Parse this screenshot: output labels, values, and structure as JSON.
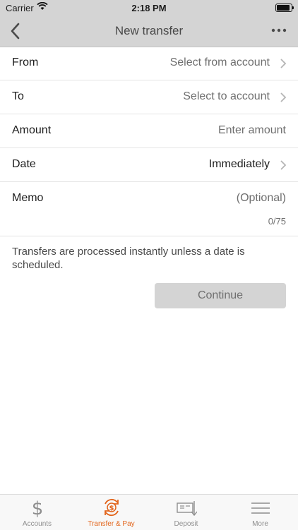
{
  "status": {
    "carrier": "Carrier",
    "time": "2:18 PM"
  },
  "nav": {
    "title": "New transfer",
    "back_icon": "chevron-left-icon",
    "more_icon": "more-horizontal-icon"
  },
  "form": {
    "from": {
      "label": "From",
      "value": "Select from account"
    },
    "to": {
      "label": "To",
      "value": "Select to account"
    },
    "amount": {
      "label": "Amount",
      "placeholder": "Enter amount"
    },
    "date": {
      "label": "Date",
      "value": "Immediately"
    },
    "memo": {
      "label": "Memo",
      "placeholder": "(Optional)",
      "counter": "0/75"
    }
  },
  "note": "Transfers are processed instantly unless a date is scheduled.",
  "continue_label": "Continue",
  "tabs": [
    {
      "label": "Accounts",
      "icon": "dollar-icon"
    },
    {
      "label": "Transfer & Pay",
      "icon": "transfer-pay-icon",
      "active": true
    },
    {
      "label": "Deposit",
      "icon": "check-deposit-icon"
    },
    {
      "label": "More",
      "icon": "menu-icon"
    }
  ],
  "colors": {
    "accent": "#e2651c",
    "bar": "#d4d4d4",
    "button": "#d4d4d4"
  }
}
